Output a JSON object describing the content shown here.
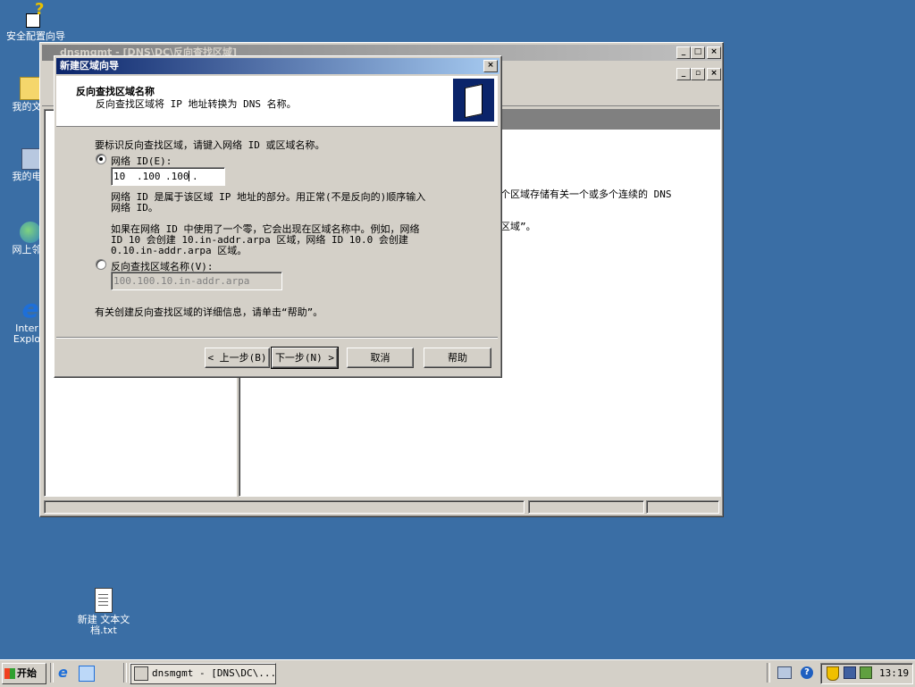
{
  "desktop": {
    "icons": [
      {
        "name": "security-config-wizard",
        "label": "安全配置向导"
      },
      {
        "name": "my-documents",
        "label": "我的文"
      },
      {
        "name": "my-computer",
        "label": "我的电"
      },
      {
        "name": "network-neighborhood",
        "label": "网上邻"
      },
      {
        "name": "internet-explorer",
        "label_1": "Inter",
        "label_2": "Explo"
      },
      {
        "name": "new-text-document",
        "label_1": "新建 文本文",
        "label_2": "档.txt"
      }
    ]
  },
  "dnsmgmt": {
    "title": "dnsmgmt - [DNS\\DC\\反向查找区域]",
    "description_1": "个区域存储有关一个或多个连续的 DNS",
    "description_2": "区域”。"
  },
  "wizard": {
    "title": "新建区域向导",
    "header_title": "反向查找区域名称",
    "header_subtitle": "反向查找区域将 IP 地址转换为 DNS 名称。",
    "instruction": "要标识反向查找区域，请键入网络 ID 或区域名称。",
    "option_network_id": "网络 ID(E):",
    "network_id_octets": [
      "10",
      ".100",
      ".100",
      "."
    ],
    "network_id_help_1": "网络 ID 是属于该区域 IP 地址的部分。用正常(不是反向的)顺序输入",
    "network_id_help_2": "网络 ID。",
    "zero_note_1": "如果在网络 ID 中使用了一个零，它会出现在区域名称中。例如，网络",
    "zero_note_2": "ID 10 会创建 10.in-addr.arpa 区域，网络 ID 10.0 会创建",
    "zero_note_3": "0.10.in-addr.arpa 区域。",
    "option_zone_name": "反向查找区域名称(V):",
    "zone_name_value": "100.100.10.in-addr.arpa",
    "help_hint": "有关创建反向查找区域的详细信息，请单击“帮助”。",
    "buttons": {
      "back": "< 上一步(B)",
      "next": "下一步(N) >",
      "cancel": "取消",
      "help": "帮助"
    }
  },
  "taskbar": {
    "start_label": "开始",
    "task_label": "dnsmgmt - [DNS\\DC\\...",
    "clock": "13:19"
  }
}
